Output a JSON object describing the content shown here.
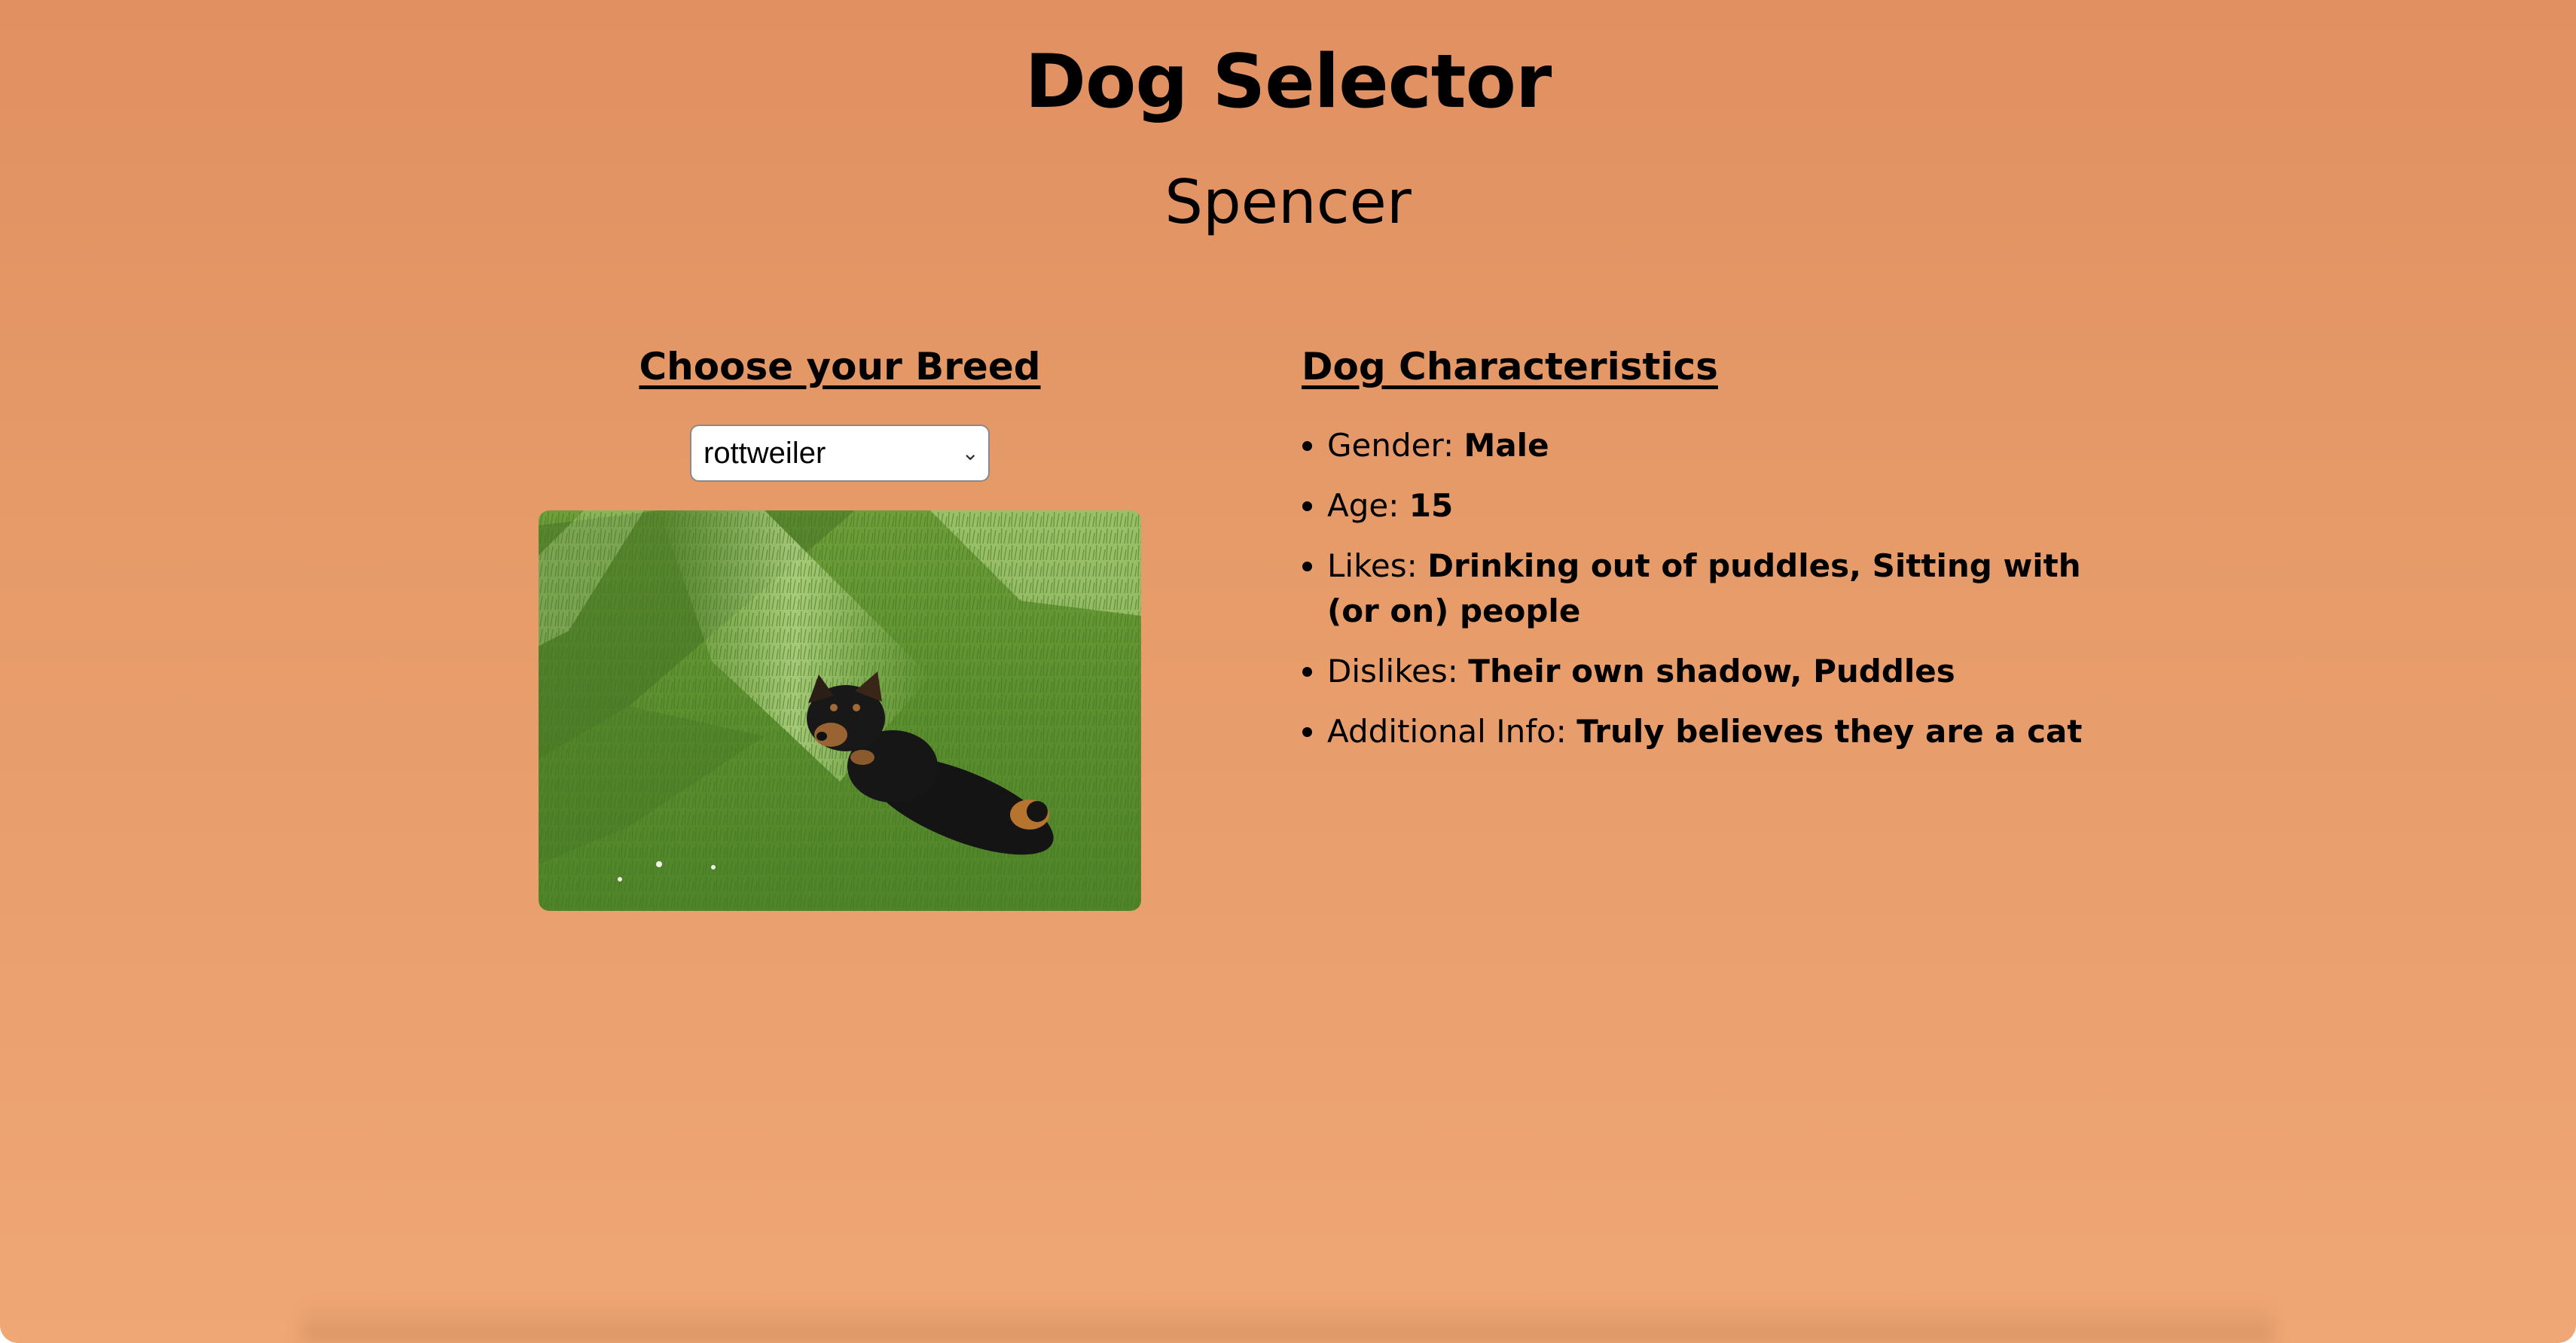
{
  "header": {
    "title": "Dog Selector",
    "subtitle": "Spencer"
  },
  "breed_panel": {
    "heading": "Choose your Breed",
    "selected_breed": "rottweiler",
    "photo_icon": "dog-in-grass-photo"
  },
  "characteristics": {
    "heading": "Dog Characteristics",
    "items": [
      {
        "label": "Gender:",
        "value": "Male"
      },
      {
        "label": "Age:",
        "value": "15"
      },
      {
        "label": "Likes:",
        "value": "Drinking out of puddles, Sitting with (or on) people"
      },
      {
        "label": "Dislikes:",
        "value": "Their own shadow, Puddles"
      },
      {
        "label": "Additional Info:",
        "value": "Truly believes they are a cat"
      }
    ]
  },
  "colors": {
    "background_top": "#e19061",
    "background_bottom": "#efa775"
  }
}
